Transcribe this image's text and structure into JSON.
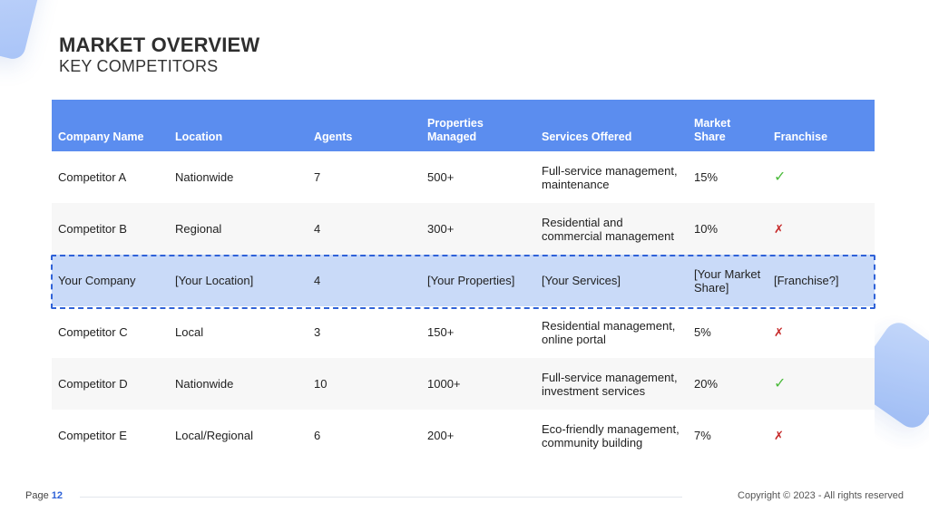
{
  "header": {
    "title": "MARKET OVERVIEW",
    "subtitle": "KEY COMPETITORS"
  },
  "table": {
    "columns": [
      "Company Name",
      "Location",
      "Agents",
      "Properties Managed",
      "Services Offered",
      "Market Share",
      "Franchise"
    ],
    "rows": [
      {
        "company": "Competitor A",
        "location": "Nationwide",
        "agents": "7",
        "properties": "500+",
        "services": "Full-service management, maintenance",
        "share": "15%",
        "franchise": "✓",
        "franchise_icon": "check-icon"
      },
      {
        "company": "Competitor B",
        "location": "Regional",
        "agents": "4",
        "properties": "300+",
        "services": "Residential and commercial management",
        "share": "10%",
        "franchise": "✗",
        "franchise_icon": "cross-icon"
      },
      {
        "company": "Your Company",
        "location": "[Your Location]",
        "agents": "4",
        "properties": "[Your Properties]",
        "services": "[Your Services]",
        "share": "[Your Market Share]",
        "franchise": "[Franchise?]",
        "franchise_icon": ""
      },
      {
        "company": "Competitor C",
        "location": "Local",
        "agents": "3",
        "properties": "150+",
        "services": "Residential management, online portal",
        "share": "5%",
        "franchise": "✗",
        "franchise_icon": "cross-icon"
      },
      {
        "company": "Competitor D",
        "location": "Nationwide",
        "agents": "10",
        "properties": "1000+",
        "services": "Full-service management, investment services",
        "share": "20%",
        "franchise": "✓",
        "franchise_icon": "check-icon"
      },
      {
        "company": "Competitor E",
        "location": "Local/Regional",
        "agents": "6",
        "properties": "200+",
        "services": "Eco-friendly management, community building",
        "share": "7%",
        "franchise": "✗",
        "franchise_icon": "cross-icon"
      }
    ]
  },
  "footer": {
    "page_label": "Page",
    "page_number": "12",
    "copyright": "Copyright © 2023 - All rights reserved"
  },
  "colors": {
    "header_bg": "#5b8def",
    "highlight_bg": "#c9daf8",
    "highlight_border": "#2f62d8",
    "check": "#4cbb3c",
    "cross": "#c62828"
  }
}
